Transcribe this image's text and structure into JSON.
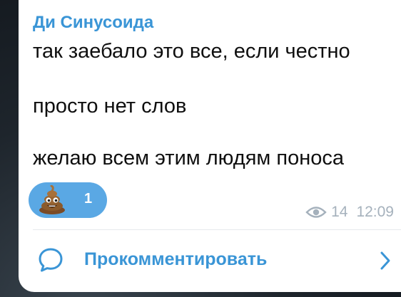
{
  "message": {
    "sender_name": "Ди Синусоида",
    "lines": [
      "так заебало это все, если честно",
      "просто нет слов",
      "желаю всем этим людям поноса"
    ],
    "reaction": {
      "emoji": "pile-of-poo",
      "count": "1"
    },
    "views": "14",
    "time": "12:09"
  },
  "comments": {
    "label": "Прокомментировать"
  },
  "colors": {
    "accent": "#3a95d6",
    "reaction_bg": "#5aa8e4",
    "meta_text": "#a5b1bc",
    "bubble_bg": "#ffffff"
  },
  "icons": [
    "pile-of-poo-icon",
    "eye-icon",
    "comment-icon",
    "chevron-right-icon"
  ]
}
